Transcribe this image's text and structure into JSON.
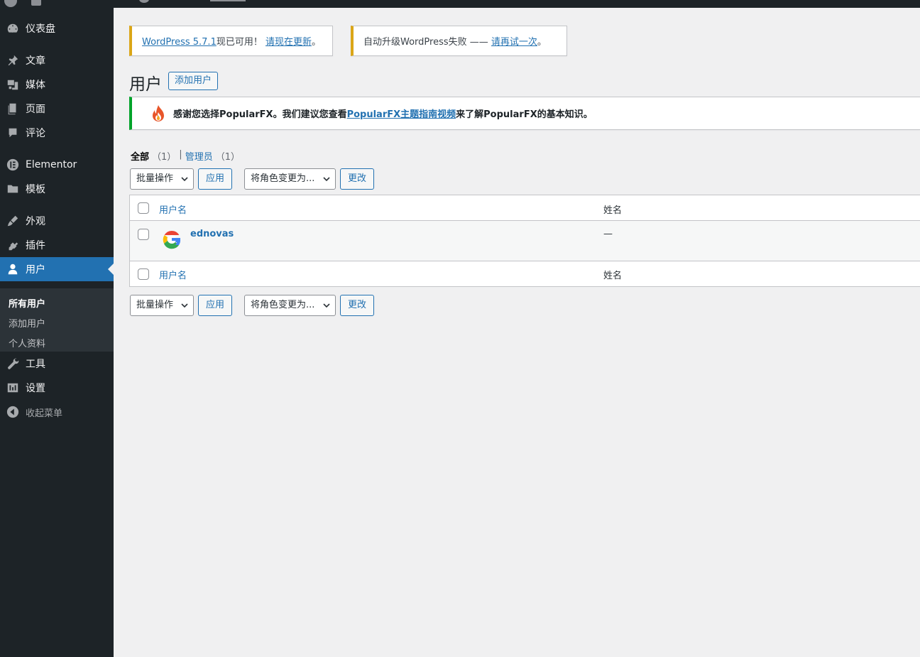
{
  "sidebar": {
    "items": [
      {
        "label": "仪表盘",
        "icon": "dashboard-icon"
      },
      {
        "label": "文章",
        "icon": "pin-icon"
      },
      {
        "label": "媒体",
        "icon": "media-icon"
      },
      {
        "label": "页面",
        "icon": "page-icon"
      },
      {
        "label": "评论",
        "icon": "comment-icon"
      },
      {
        "label": "Elementor",
        "icon": "elementor-icon"
      },
      {
        "label": "模板",
        "icon": "folder-icon"
      },
      {
        "label": "外观",
        "icon": "brush-icon"
      },
      {
        "label": "插件",
        "icon": "plugin-icon"
      },
      {
        "label": "用户",
        "icon": "user-icon"
      },
      {
        "label": "工具",
        "icon": "wrench-icon"
      },
      {
        "label": "设置",
        "icon": "settings-icon"
      },
      {
        "label": "收起菜单",
        "icon": "collapse-icon"
      }
    ],
    "submenu": [
      "所有用户",
      "添加用户",
      "个人资料"
    ]
  },
  "notices": {
    "update": {
      "link": "WordPress 5.7.1",
      "text": "现已可用！",
      "action": "请现在更新",
      "end": "。"
    },
    "autoupdate": {
      "text": "自动升级WordPress失败 —— ",
      "action": "请再试一次",
      "end": "。"
    },
    "popularfx": {
      "before": "感谢您选择PopularFX。我们建议您查看",
      "link": "PopularFX主题指南视频",
      "after": "来了解PopularFX的基本知识。"
    }
  },
  "page": {
    "title": "用户",
    "add_new": "添加用户"
  },
  "filters": {
    "all": "全部",
    "all_count": "（1）",
    "sep": "|",
    "admin": "管理员",
    "admin_count": "（1）"
  },
  "actions": {
    "bulk": "批量操作",
    "apply": "应用",
    "role": "将角色变更为...",
    "change": "更改"
  },
  "table": {
    "col_username": "用户名",
    "col_name": "姓名",
    "rows": [
      {
        "username": "ednovas",
        "name": "—"
      }
    ]
  }
}
